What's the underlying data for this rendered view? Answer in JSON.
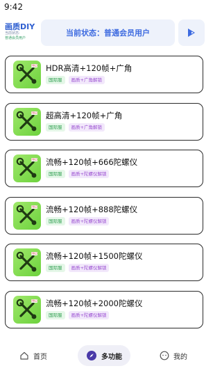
{
  "status_bar": {
    "time": "9:42"
  },
  "header": {
    "brand_title": "画质DIY",
    "brand_sub_1": "当前状态:",
    "brand_sub_2": "普通会员用户",
    "status_text": "当前状态：普通会员用户",
    "play_icon": "play-icon",
    "accent_color": "#3e6be0"
  },
  "cards": [
    {
      "title": "HDR高清+120帧+广角",
      "tags": [
        "国际服",
        "画质+广角解锁"
      ]
    },
    {
      "title": "超高清+120帧+广角",
      "tags": [
        "国际服",
        "画质+广角解锁"
      ]
    },
    {
      "title": "流畅+120帧+666陀螺仪",
      "tags": [
        "国际服",
        "画质+陀螺仪解锁"
      ]
    },
    {
      "title": "流畅+120帧+888陀螺仪",
      "tags": [
        "国际服",
        "画质+陀螺仪解锁"
      ]
    },
    {
      "title": "流畅+120帧+1500陀螺仪",
      "tags": [
        "国际服",
        "画质+陀螺仪解锁"
      ]
    },
    {
      "title": "流畅+120帧+2000陀螺仪",
      "tags": [
        "国际服",
        "画质+陀螺仪解锁"
      ]
    }
  ],
  "card_icon": "tools-icon",
  "tabbar": {
    "home": "首页",
    "multi": "多功能",
    "mine": "我的",
    "active": "multi"
  }
}
